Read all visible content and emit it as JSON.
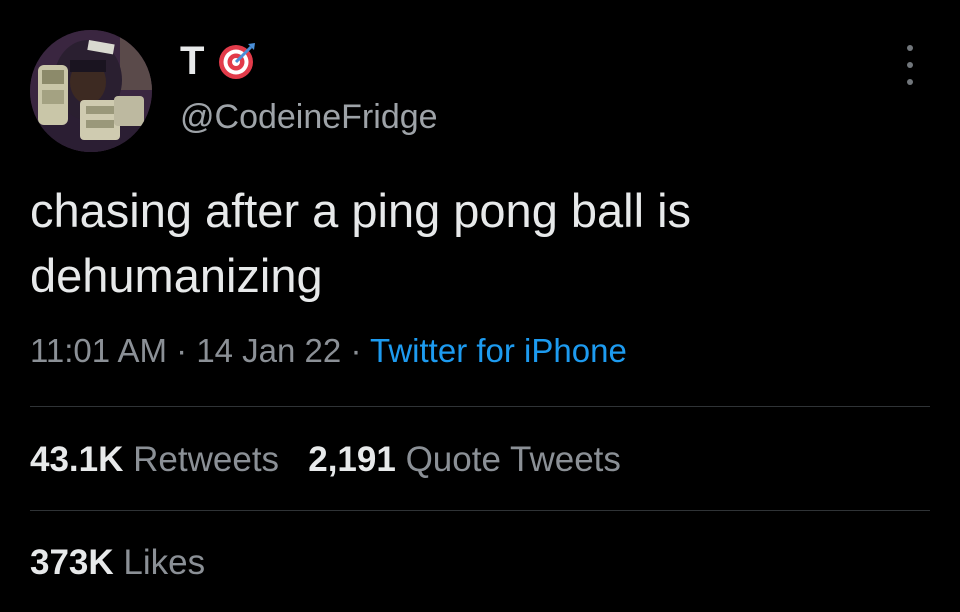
{
  "author": {
    "name": "T",
    "badge_icon": "target-icon",
    "handle": "@CodeineFridge",
    "avatar_icon": "avatar"
  },
  "tweet": {
    "text_line1": "chasing after a ping pong ball is",
    "text_line2": "dehumanizing",
    "time": "11:01 AM",
    "separator": " · ",
    "date": "14 Jan 22",
    "source": "Twitter for iPhone"
  },
  "stats": {
    "retweets_count": "43.1K",
    "retweets_label": "Retweets",
    "quotes_count": "2,191",
    "quotes_label": "Quote Tweets",
    "likes_count": "373K",
    "likes_label": "Likes"
  },
  "more_icon": "more-options-icon",
  "colors": {
    "background": "#000000",
    "text": "#e7e9ea",
    "muted": "#8b9096",
    "link": "#1d9bf0",
    "divider": "#2f3336"
  }
}
